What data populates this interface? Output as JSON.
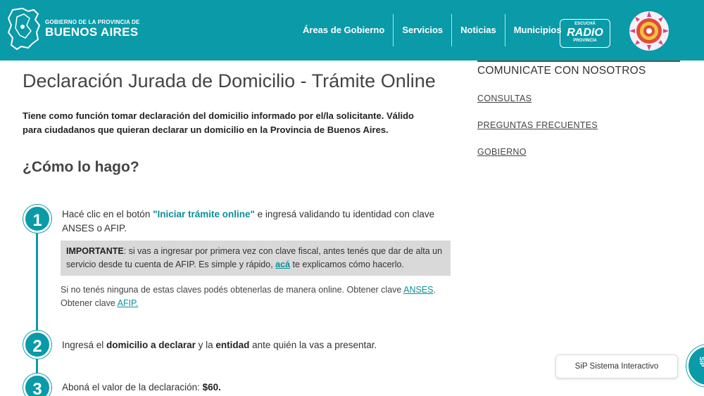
{
  "header": {
    "logo_small": "GOBIERNO DE LA PROVINCIA DE",
    "logo_big": "BUENOS AIRES",
    "nav": [
      {
        "label": "Áreas de Gobierno"
      },
      {
        "label": "Servicios"
      },
      {
        "label": "Noticias"
      },
      {
        "label": "Municipios"
      }
    ],
    "radio": {
      "top": "ESCUCHÁ",
      "main": "RADIO",
      "bottom": "PROVINCIA"
    }
  },
  "main": {
    "title": "Declaración Jurada de Domicilio - Trámite Online",
    "intro": "Tiene como función tomar declaración del domicilio informado por el/la solicitante. Válido para ciudadanos que quieran declarar un domicilio en la Provincia de Buenos Aires.",
    "howto": "¿Cómo lo hago?",
    "steps": [
      {
        "number": "1",
        "pre": "Hacé clic en el botón ",
        "link": "\"Iniciar trámite online\"",
        "post": " e ingresá validando tu identidad con clave ANSES o AFIP."
      },
      {
        "number": "2",
        "pre": "Ingresá el ",
        "bold1": "domicilio a declarar",
        "mid": " y la ",
        "bold2": "entidad",
        "post": " ante quién la vas a presentar."
      },
      {
        "number": "3",
        "pre": "Aboná el valor de la declaración: ",
        "bold": "$60."
      }
    ],
    "important": {
      "label": "IMPORTANTE",
      "text": ": si vas a ingresar por primera vez con clave fiscal, antes tenés que dar de alta un servicio desde tu cuenta de AFIP. Es simple y rápido, ",
      "link": "acá",
      "post": " te explicamos cómo hacerlo."
    },
    "note": {
      "text": "Si no tenés ninguna de estas claves podés obtenerlas de manera online. Obtener clave ",
      "link1": "ANSES",
      "mid": ". Obtener clave ",
      "link2": "AFIP."
    }
  },
  "sidebar": {
    "title": "COMUNICATE CON NOSOTROS",
    "links": [
      {
        "label": "CONSULTAS"
      },
      {
        "label": "PREGUNTAS FRECUENTES"
      },
      {
        "label": "GOBIERNO"
      }
    ]
  },
  "sip": {
    "label": "SiP Sistema Interactivo",
    "bubble": "SiP"
  },
  "colors": {
    "brand": "#0a9aa8",
    "important_bg": "#d9d9d9"
  }
}
